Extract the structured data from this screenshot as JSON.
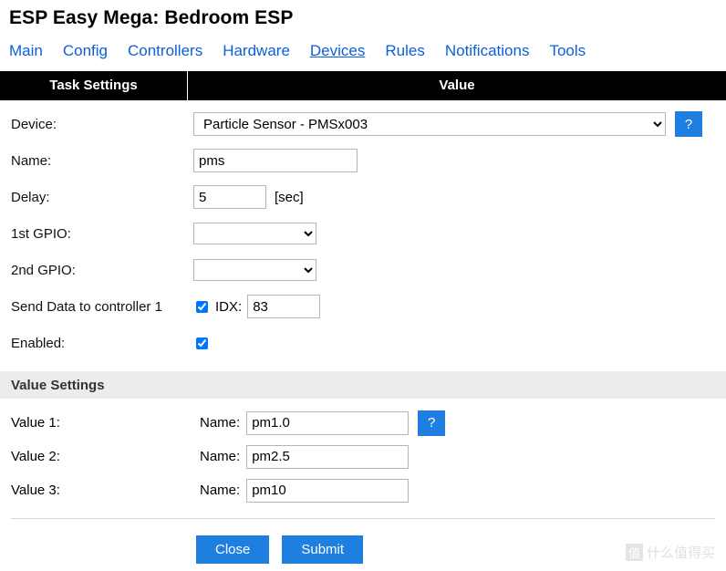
{
  "page": {
    "title": "ESP Easy Mega: Bedroom ESP"
  },
  "nav": {
    "items": [
      {
        "label": "Main",
        "active": false
      },
      {
        "label": "Config",
        "active": false
      },
      {
        "label": "Controllers",
        "active": false
      },
      {
        "label": "Hardware",
        "active": false
      },
      {
        "label": "Devices",
        "active": true
      },
      {
        "label": "Rules",
        "active": false
      },
      {
        "label": "Notifications",
        "active": false
      },
      {
        "label": "Tools",
        "active": false
      }
    ]
  },
  "table_head": {
    "left": "Task Settings",
    "right": "Value"
  },
  "form": {
    "device_label": "Device:",
    "device_value": "Particle Sensor - PMSx003",
    "device_help": "?",
    "name_label": "Name:",
    "name_value": "pms",
    "delay_label": "Delay:",
    "delay_value": "5",
    "delay_unit": "[sec]",
    "gpio1_label": "1st GPIO:",
    "gpio1_value": "",
    "gpio2_label": "2nd GPIO:",
    "gpio2_value": "",
    "send_data_label": "Send Data to controller 1",
    "idx_label": "IDX:",
    "idx_value": "83",
    "enabled_label": "Enabled:"
  },
  "value_settings": {
    "section_title": "Value Settings",
    "help": "?",
    "rows": [
      {
        "label": "Value 1:",
        "name_label": "Name:",
        "value": "pm1.0"
      },
      {
        "label": "Value 2:",
        "name_label": "Name:",
        "value": "pm2.5"
      },
      {
        "label": "Value 3:",
        "name_label": "Name:",
        "value": "pm10"
      }
    ]
  },
  "footer": {
    "close": "Close",
    "submit": "Submit"
  },
  "watermark": {
    "badge": "值",
    "text": "什么值得买"
  },
  "colors": {
    "accent": "#1f7fe0",
    "link": "#0b5fd8",
    "header_bg": "#000000",
    "section_bg": "#ececec"
  }
}
